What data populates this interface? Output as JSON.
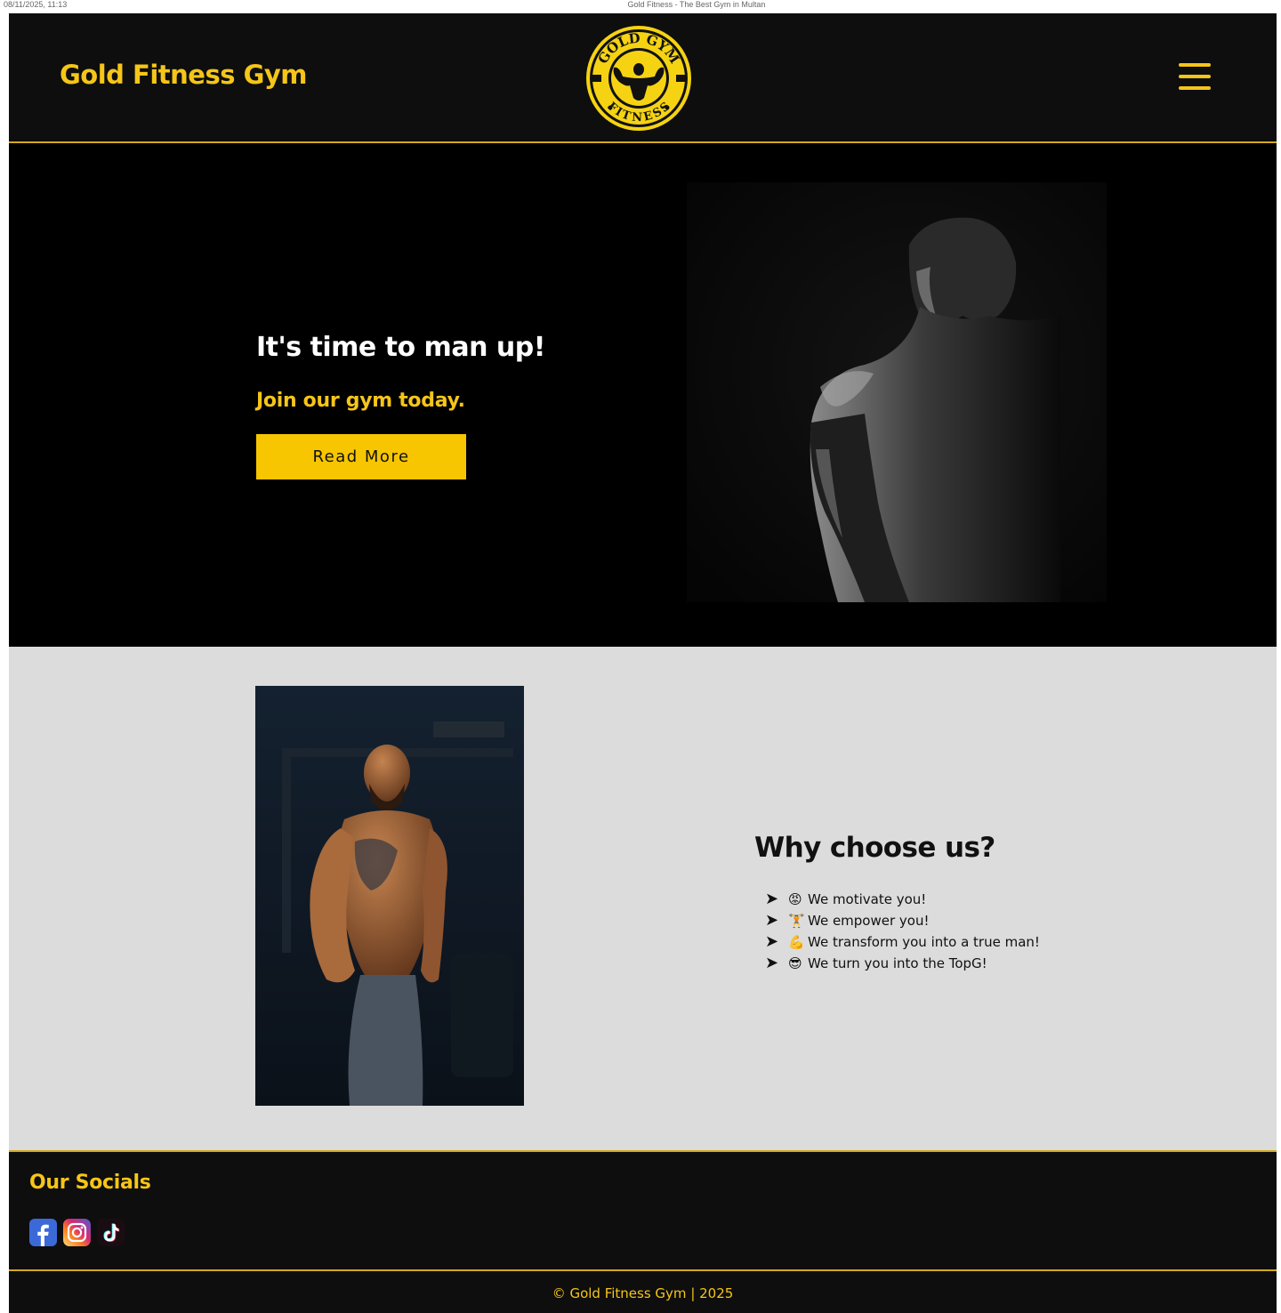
{
  "print_header": {
    "left": "08/11/2025, 11:13",
    "center": "Gold Fitness - The Best Gym in Multan"
  },
  "header": {
    "brand": "Gold Fitness Gym",
    "logo_top_text": "GOLD GYM",
    "logo_bottom_text": "FITNESS",
    "menu_icon": "hamburger-menu-icon"
  },
  "hero": {
    "title": "It's time to man up!",
    "subtitle": "Join our gym today.",
    "button_label": "Read More"
  },
  "why": {
    "title": "Why choose us?",
    "items": [
      {
        "emoji": "😡",
        "text": "We motivate you!"
      },
      {
        "emoji": "🏋",
        "text": "We empower you!"
      },
      {
        "emoji": "💪",
        "text": "We transform you into a true man!"
      },
      {
        "emoji": "😎",
        "text": "We turn you into the TopG!"
      }
    ],
    "bullet": "➤"
  },
  "socials": {
    "title": "Our Socials",
    "icons": [
      "facebook-icon",
      "instagram-icon",
      "tiktok-icon"
    ]
  },
  "footer": {
    "copyright": "© Gold Fitness Gym | 2025"
  },
  "colors": {
    "accent": "#f5c518",
    "header_bg": "#0e0e0e",
    "hero_bg": "#000000",
    "section_bg": "#dcdcdc",
    "button_bg": "#f7c600"
  }
}
